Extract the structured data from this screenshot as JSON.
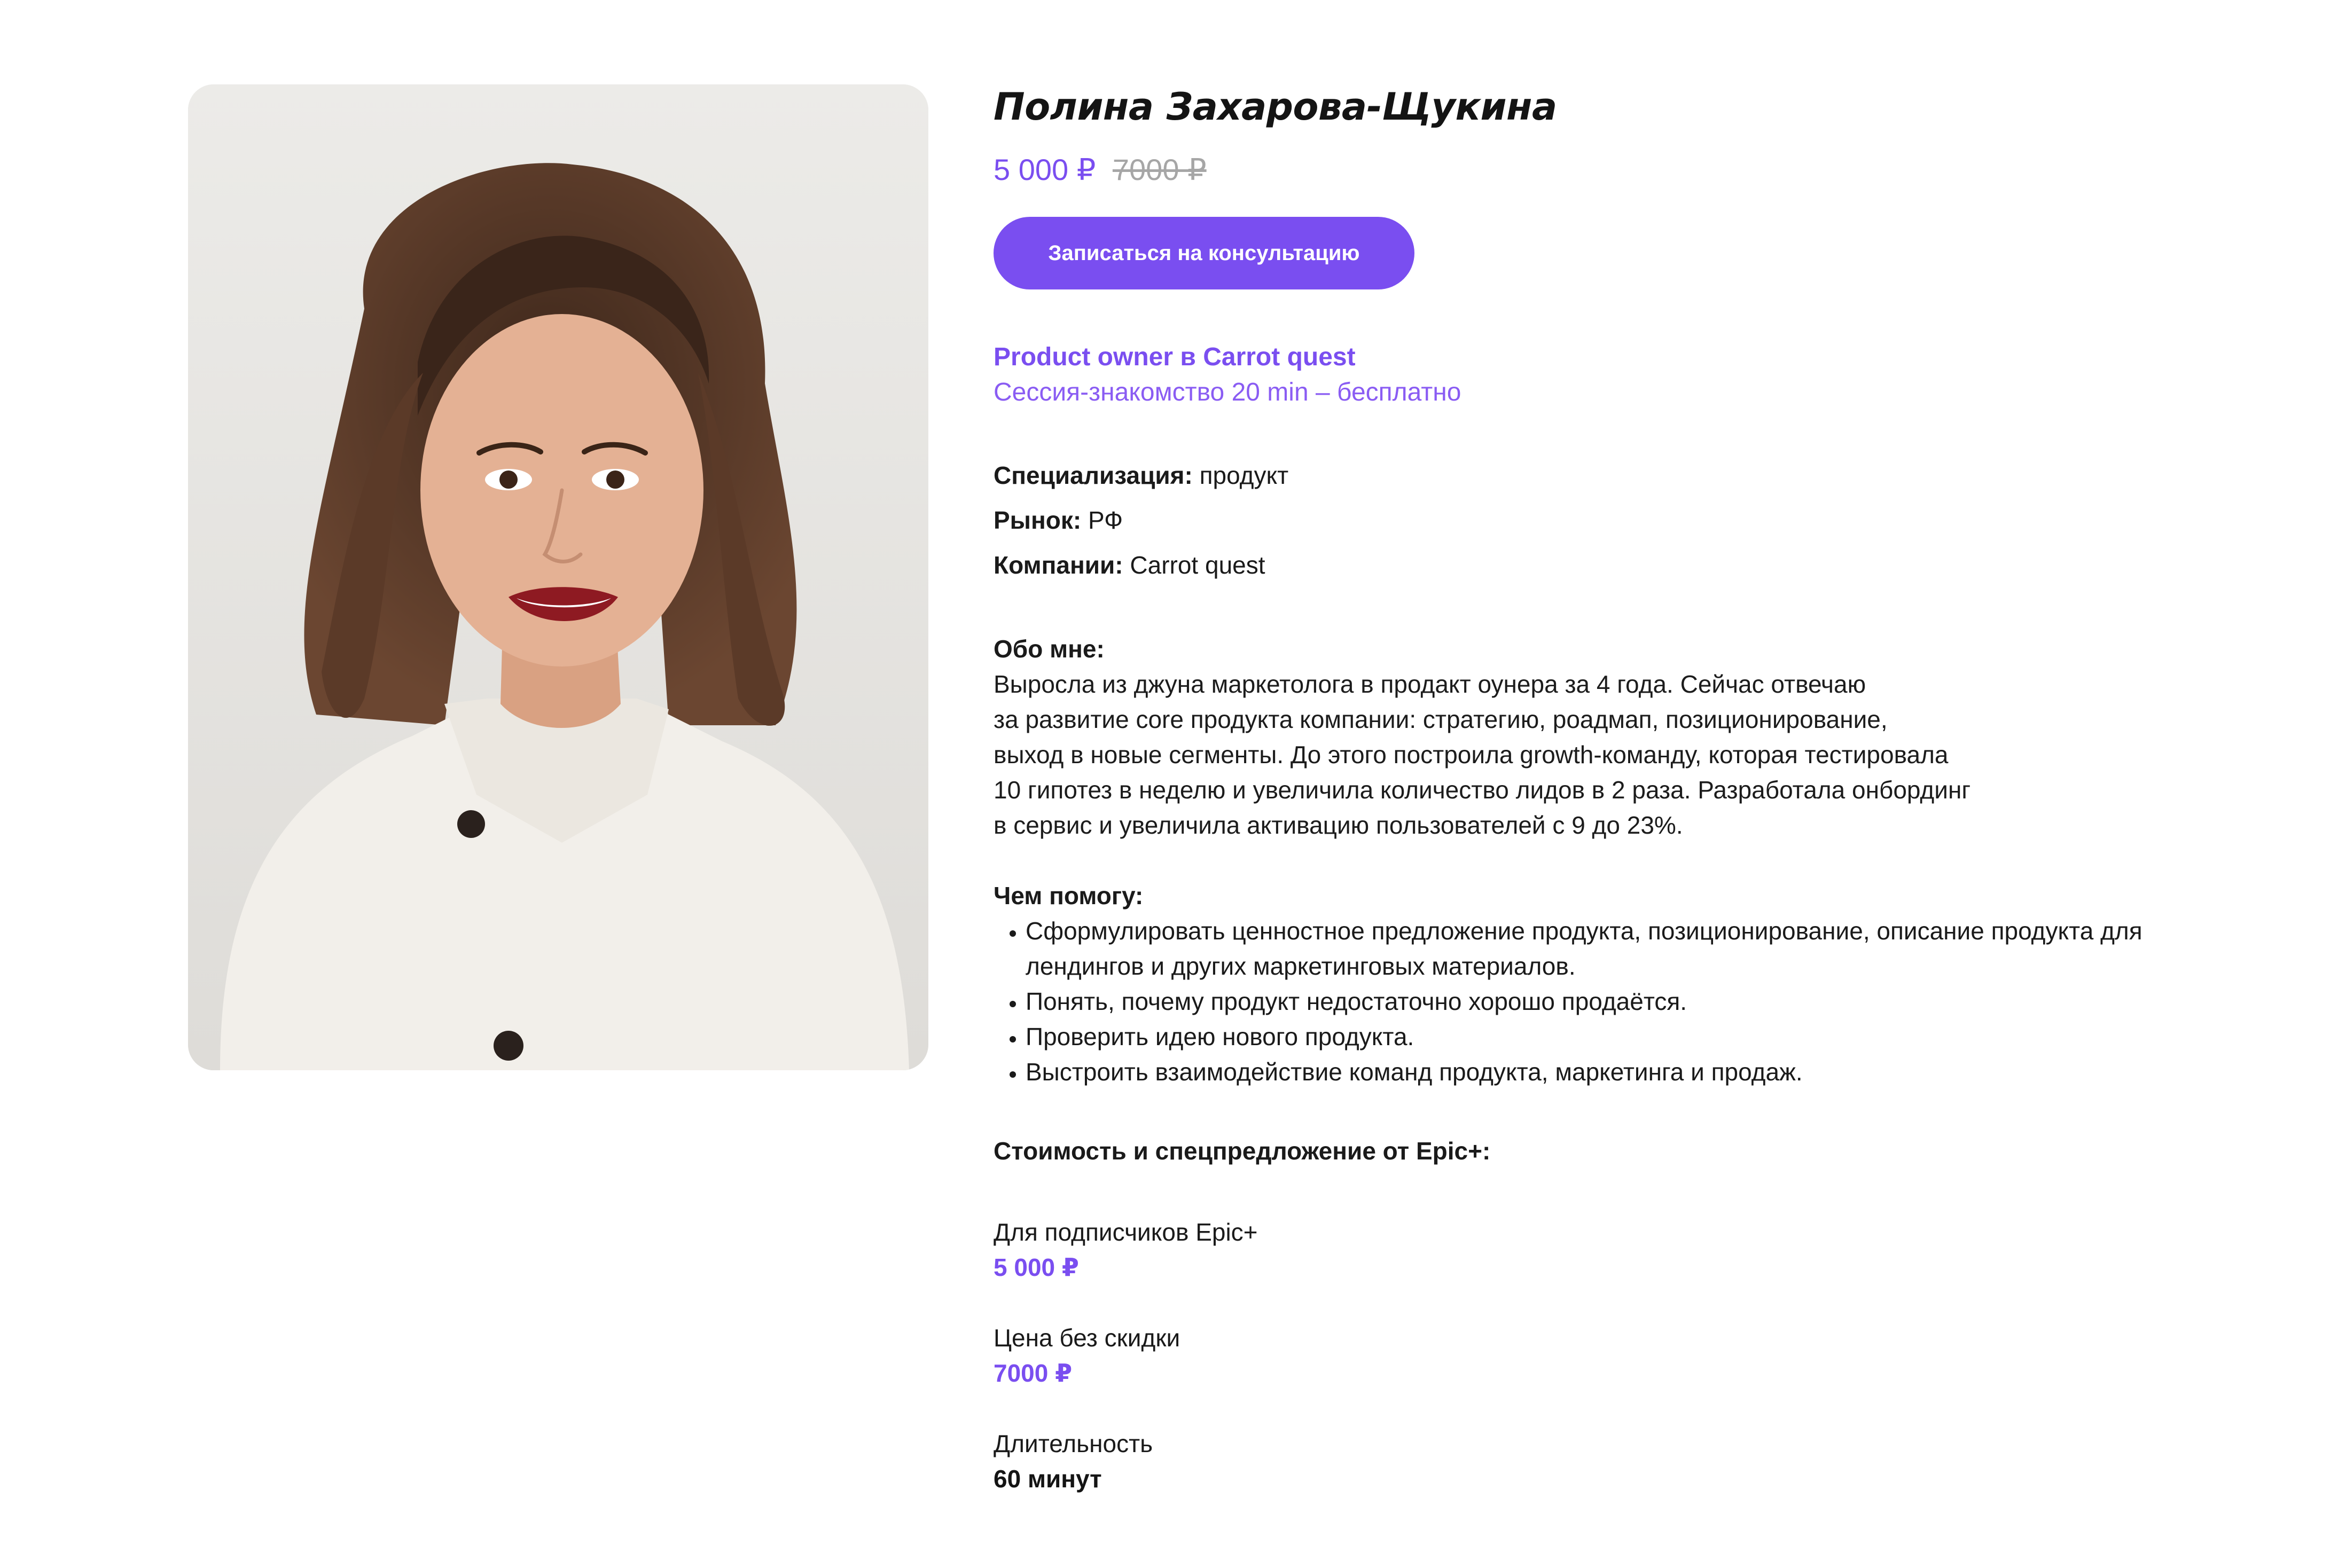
{
  "profile": {
    "name": "Полина Захарова-Щукина",
    "price_current": "5 000 ₽",
    "price_old": "7000 ₽",
    "cta_label": "Записаться на консультацию",
    "role": "Product owner в Carrot quest",
    "session": "Сессия-знакомство 20 min – бесплатно"
  },
  "facts": {
    "specialization_label": "Специализация:",
    "specialization_value": "продукт",
    "market_label": "Рынок:",
    "market_value": "РФ",
    "companies_label": "Компании:",
    "companies_value": "Carrot quest"
  },
  "about": {
    "title": "Обо мне:",
    "text": "Выросла из джуна маркетолога в продакт оунера за 4 года. Сейчас отвечаю\nза развитие core продукта компании: стратегию, роадмап, позиционирование,\nвыход в новые сегменты. До этого построила growth-команду, которая тестировала\n10 гипотез в неделю и увеличила количество лидов в 2 раза. Разработала онбординг\nв сервис и увеличила активацию пользователей с 9 до 23%."
  },
  "help": {
    "title": "Чем помогу:",
    "items": [
      "Сформулировать ценностное предложение продукта, позиционирование, описание продукта для лендингов и других маркетинговых материалов.",
      "Понять, почему продукт недостаточно хорошо продаётся.",
      "Проверить идею нового продукта.",
      "Выстроить взаимодействие команд продукта, маркетинга и продаж."
    ]
  },
  "pricing": {
    "title": "Стоимость и спецпредложение от Epic+:",
    "subscribers_label": "Для подписчиков Epic+",
    "subscribers_price": "5 000 ₽",
    "regular_label": "Цена без скидки",
    "regular_price": "7000 ₽",
    "duration_label": "Длительность",
    "duration_value": "60 минут"
  },
  "colors": {
    "accent": "#7a4ef0",
    "text": "#1a1a1a",
    "muted": "#a6a6a6",
    "photo_background": "#e9e8e6"
  }
}
